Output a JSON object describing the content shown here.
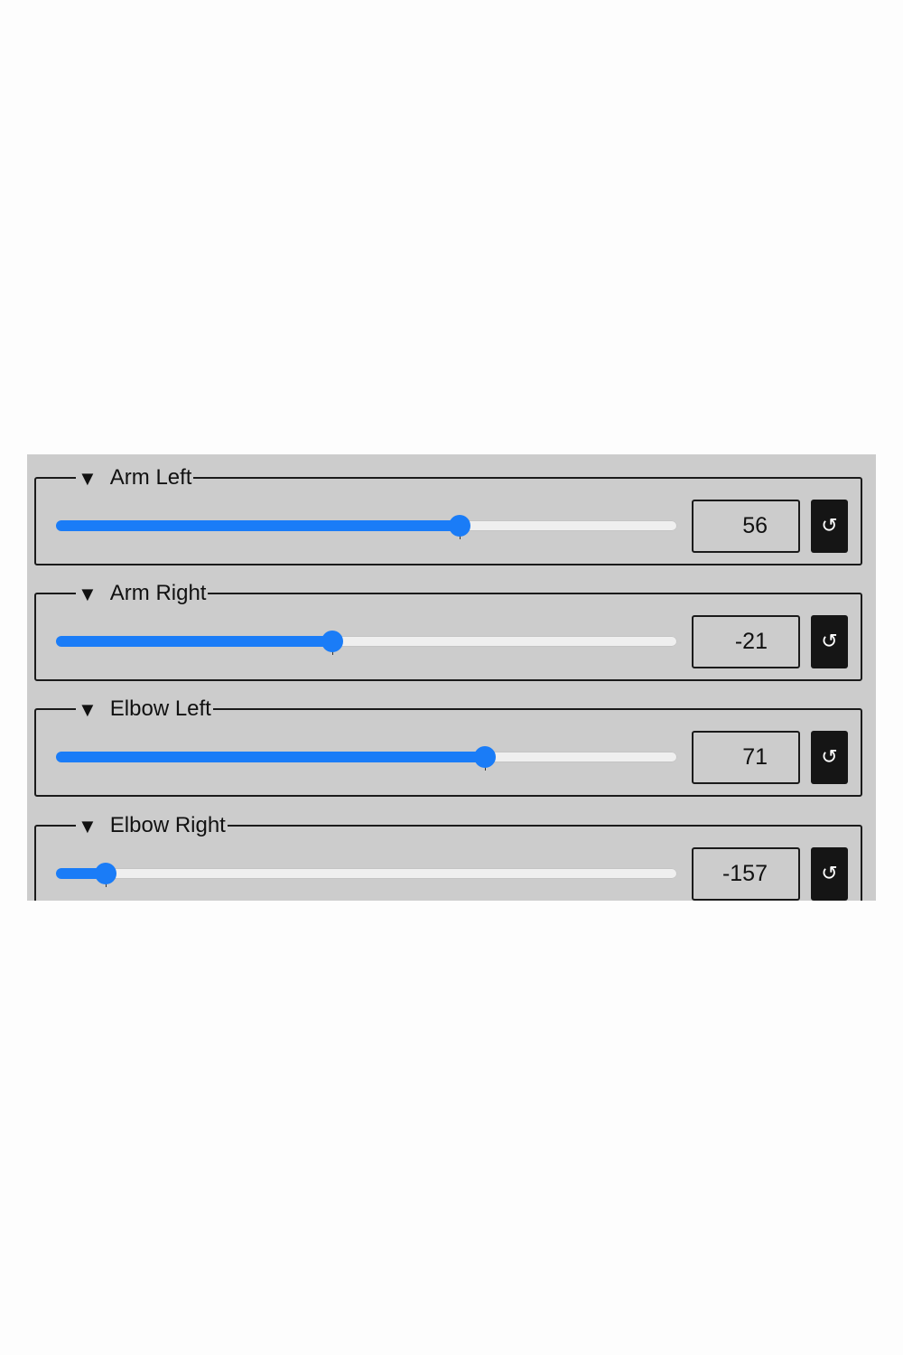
{
  "panel": {
    "background": "#cccccc",
    "accent": "#1a7cf7",
    "controls": [
      {
        "label": "Arm Left",
        "value": "56",
        "level": 0.65,
        "expanded_icon": "triangle-down-icon",
        "reset_icon": "↺"
      },
      {
        "label": "Arm Right",
        "value": "-21",
        "level": 0.445,
        "expanded_icon": "triangle-down-icon",
        "reset_icon": "↺"
      },
      {
        "label": "Elbow Left",
        "value": "71",
        "level": 0.69,
        "expanded_icon": "triangle-down-icon",
        "reset_icon": "↺"
      },
      {
        "label": "Elbow Right",
        "value": "-157",
        "level": 0.08,
        "expanded_icon": "triangle-down-icon",
        "reset_icon": "↺"
      }
    ]
  }
}
